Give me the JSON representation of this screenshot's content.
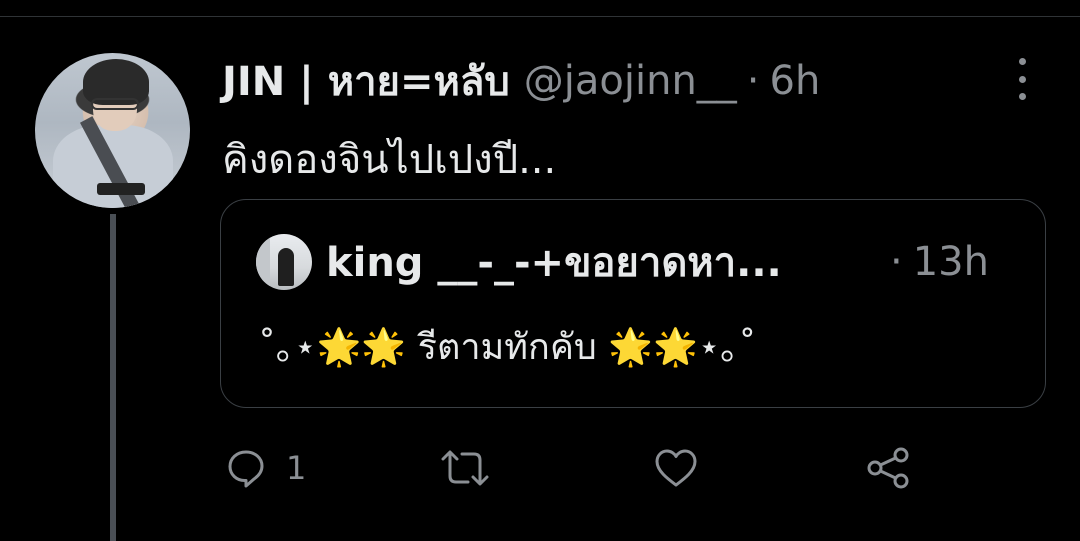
{
  "tweet": {
    "display_name": "JIN | หาย=หลับ",
    "handle": "@jaojinn__",
    "separator": "·",
    "time": "6h",
    "text": "คิงดองจินไปเปงปี..."
  },
  "quoted_tweet": {
    "display_name": "king __-_-+ขอยาดหา...",
    "separator": "·",
    "time": "13h",
    "text": "˚｡⋆🌟🌟 รีตามทักคับ 🌟🌟⋆｡˚"
  },
  "actions": {
    "reply_count": "1",
    "icons": [
      "reply-icon",
      "retweet-icon",
      "like-icon",
      "share-icon"
    ]
  },
  "colors": {
    "background": "#000000",
    "text_primary": "#e7e9ea",
    "text_secondary": "#8b8f94",
    "border": "#3a3f44"
  }
}
